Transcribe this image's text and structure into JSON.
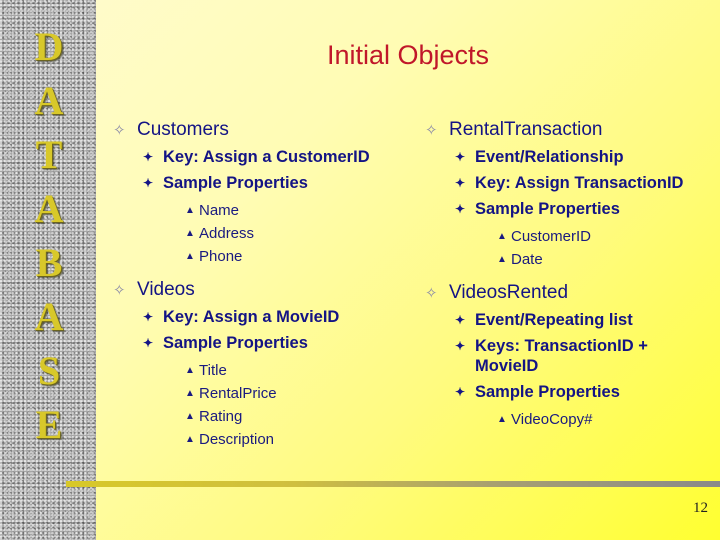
{
  "sidebar": {
    "letters": [
      "D",
      "A",
      "T",
      "A",
      "B",
      "A",
      "S",
      "E"
    ]
  },
  "slide": {
    "title": "Initial Objects",
    "page_number": "12"
  },
  "colors": {
    "title": "#c0172a",
    "text": "#141485",
    "logo": "#d8c82a"
  },
  "left_column": [
    {
      "heading": "Customers",
      "items": [
        {
          "text": "Key:  Assign a CustomerID",
          "subitems": []
        },
        {
          "text": "Sample Properties",
          "subitems": [
            "Name",
            "Address",
            "Phone"
          ]
        }
      ]
    },
    {
      "heading": "Videos",
      "items": [
        {
          "text": "Key:  Assign a MovieID",
          "subitems": []
        },
        {
          "text": "Sample Properties",
          "subitems": [
            "Title",
            "RentalPrice",
            "Rating",
            "Description"
          ]
        }
      ]
    }
  ],
  "right_column": [
    {
      "heading": "RentalTransaction",
      "items": [
        {
          "text": "Event/Relationship",
          "subitems": []
        },
        {
          "text": "Key:  Assign TransactionID",
          "subitems": []
        },
        {
          "text": "Sample Properties",
          "subitems": [
            "CustomerID",
            "Date"
          ]
        }
      ]
    },
    {
      "heading": "VideosRented",
      "items": [
        {
          "text": "Event/Repeating list",
          "subitems": []
        },
        {
          "text": "Keys:  TransactionID + MovieID",
          "subitems": []
        },
        {
          "text": "Sample Properties",
          "subitems": [
            "VideoCopy#"
          ]
        }
      ]
    }
  ],
  "icons": {
    "level1": "four-point-star-outline",
    "level2": "four-point-star-solid",
    "level3": "caret-up-triangle"
  }
}
